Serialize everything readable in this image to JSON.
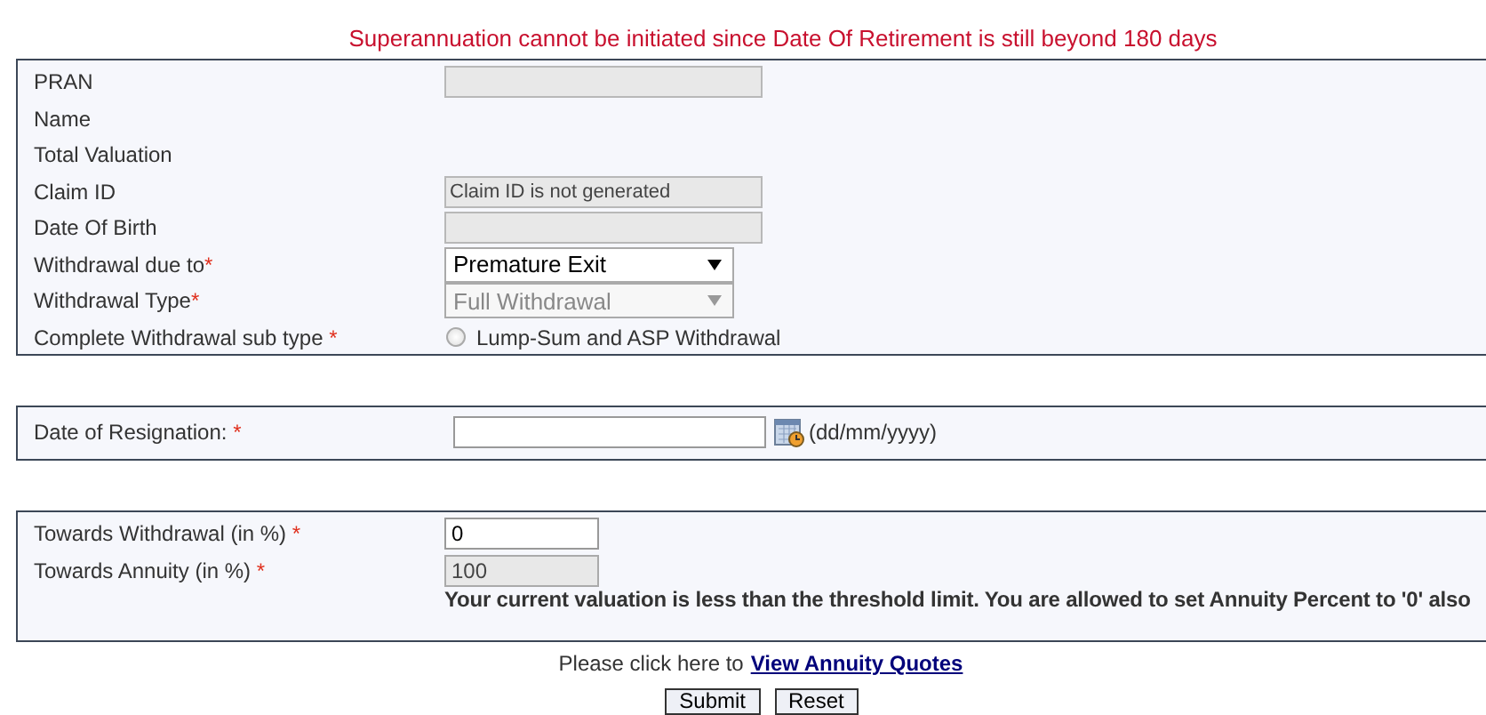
{
  "message": "Superannuation cannot be initiated since Date Of Retirement is still beyond 180 days",
  "details": [
    {
      "label": "PRAN",
      "kind": "readonly"
    },
    {
      "label": "Name",
      "kind": "text"
    },
    {
      "label": "Total Valuation",
      "kind": "text"
    },
    {
      "label": "Claim ID",
      "kind": "readonly",
      "value": "Claim ID is not generated"
    },
    {
      "label": "Date Of Birth",
      "kind": "readonly"
    },
    {
      "label": "Withdrawal due to",
      "mark": "*",
      "kind": "select",
      "value": "Premature Exit",
      "disabled": false
    },
    {
      "label": "Withdrawal Type",
      "mark": "*",
      "kind": "select",
      "value": "Full Withdrawal",
      "disabled": true
    },
    {
      "label": "Complete Withdrawal sub type",
      "mark": " *",
      "kind": "radio",
      "option": "Lump-Sum and ASP Withdrawal",
      "selected": false
    }
  ],
  "resignation": {
    "label": "Date of Resignation:",
    "mark": " *",
    "hint": "(dd/mm/yyyy)"
  },
  "percent": [
    {
      "label": "Towards Withdrawal (in %)",
      "mark": " *",
      "value": "0",
      "disabled": false
    },
    {
      "label": "Towards Annuity (in %)",
      "mark": " *",
      "value": "100",
      "disabled": true
    }
  ],
  "note": "Your current valuation is less than the threshold limit. You are allowed to set Annuity Percent to '0' also",
  "footer": {
    "prompt": "Please click here to",
    "link": "View Annuity Quotes"
  },
  "buttons": [
    "Submit",
    "Reset"
  ]
}
